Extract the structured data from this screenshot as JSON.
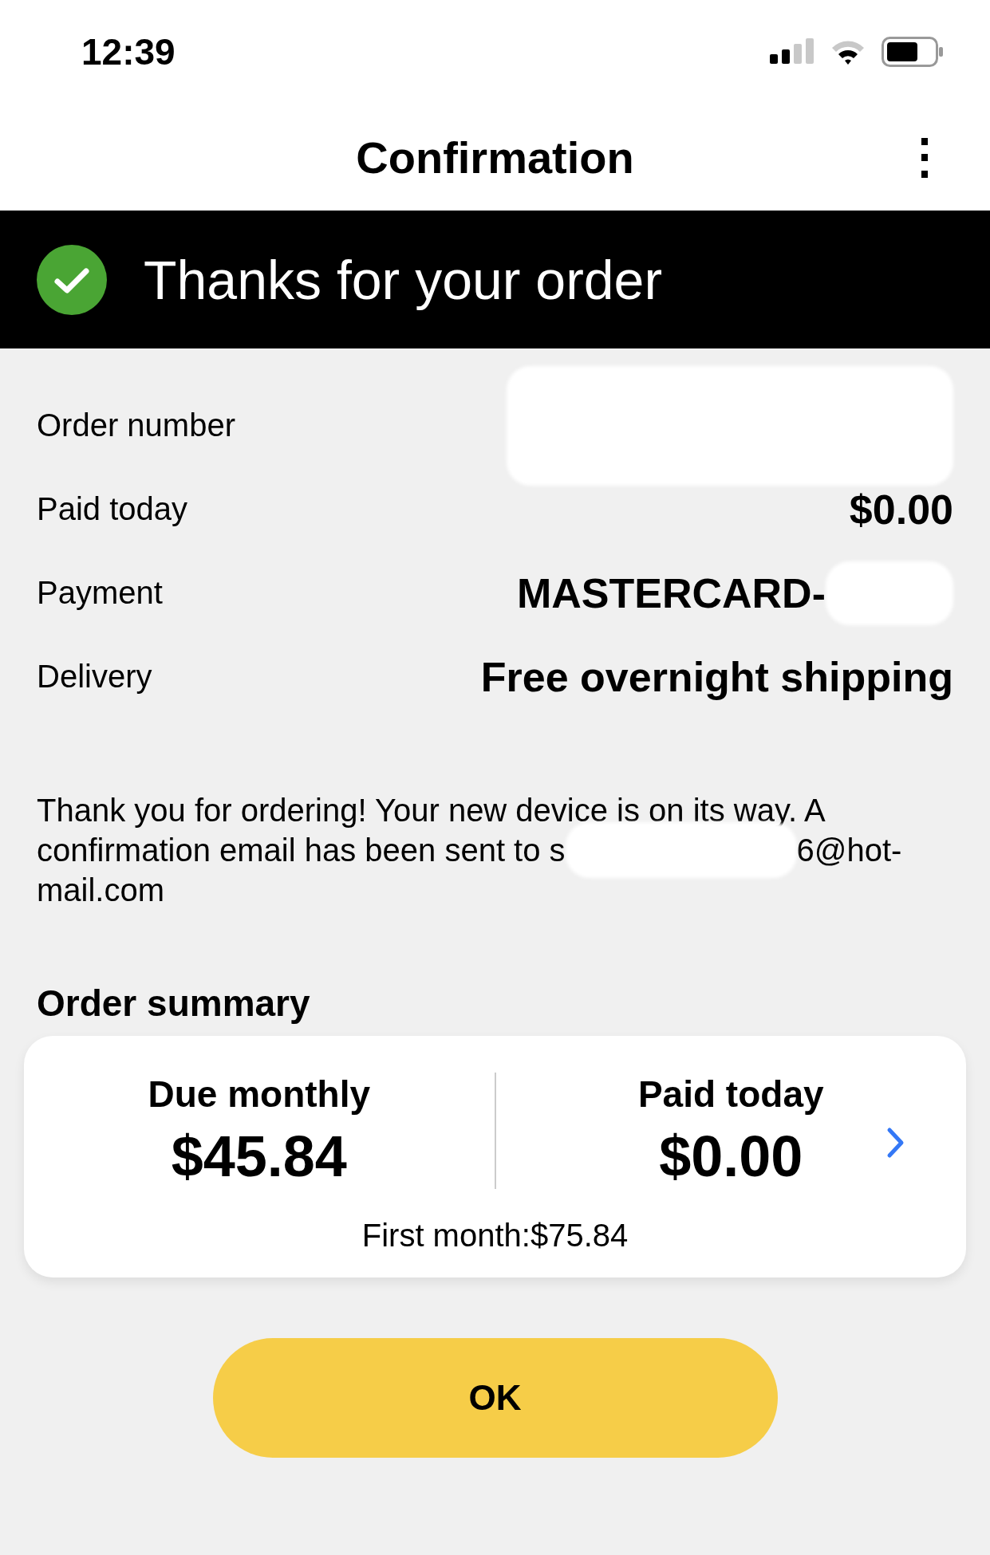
{
  "status_bar": {
    "time": "12:39"
  },
  "header": {
    "title": "Confirmation",
    "menu": "⋮"
  },
  "banner": {
    "text": "Thanks for your order"
  },
  "details": [
    {
      "label": "Order number",
      "redacted": true
    },
    {
      "label": "Paid today",
      "value": "$0.00",
      "redacted": false
    },
    {
      "label": "Payment",
      "value": "MASTERCARD-",
      "redacted": true
    },
    {
      "label": "Delivery",
      "value": "Free overnight shipping",
      "redacted": false
    }
  ],
  "message": {
    "line_1": "Thank you for ordering! Your new device is on its way. A",
    "line_2_start": "confirmation email has been sent to s",
    "line_2_end": "6@hot-",
    "line_3": "mail.com"
  },
  "summary": {
    "heading": "Order summary",
    "columns": [
      {
        "label": "Due monthly",
        "amount": "$45.84"
      },
      {
        "label": "Paid today",
        "amount": "$0.00"
      }
    ],
    "footnote": "First month:$75.84"
  },
  "ok_button": "OK"
}
